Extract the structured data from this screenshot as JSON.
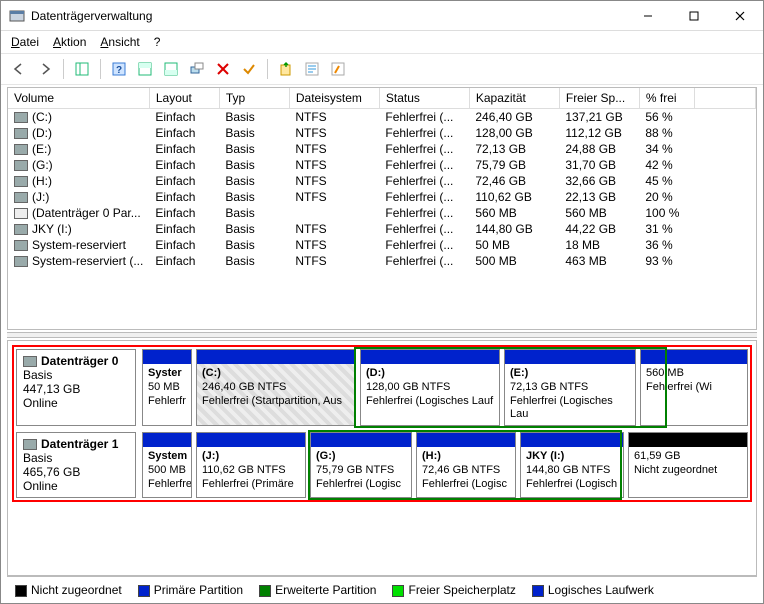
{
  "window": {
    "title": "Datenträgerverwaltung"
  },
  "menu": {
    "file": "Datei",
    "action": "Aktion",
    "view": "Ansicht",
    "help": "?"
  },
  "columns": {
    "c0": "Volume",
    "c1": "Layout",
    "c2": "Typ",
    "c3": "Dateisystem",
    "c4": "Status",
    "c5": "Kapazität",
    "c6": "Freier Sp...",
    "c7": "% frei"
  },
  "volumes": [
    {
      "name": "(C:)",
      "layout": "Einfach",
      "typ": "Basis",
      "fs": "NTFS",
      "status": "Fehlerfrei (...",
      "cap": "246,40 GB",
      "free": "137,21 GB",
      "pct": "56 %",
      "icon": "drv"
    },
    {
      "name": "(D:)",
      "layout": "Einfach",
      "typ": "Basis",
      "fs": "NTFS",
      "status": "Fehlerfrei (...",
      "cap": "128,00 GB",
      "free": "112,12 GB",
      "pct": "88 %",
      "icon": "drv"
    },
    {
      "name": "(E:)",
      "layout": "Einfach",
      "typ": "Basis",
      "fs": "NTFS",
      "status": "Fehlerfrei (...",
      "cap": "72,13 GB",
      "free": "24,88 GB",
      "pct": "34 %",
      "icon": "drv"
    },
    {
      "name": "(G:)",
      "layout": "Einfach",
      "typ": "Basis",
      "fs": "NTFS",
      "status": "Fehlerfrei (...",
      "cap": "75,79 GB",
      "free": "31,70 GB",
      "pct": "42 %",
      "icon": "drv"
    },
    {
      "name": "(H:)",
      "layout": "Einfach",
      "typ": "Basis",
      "fs": "NTFS",
      "status": "Fehlerfrei (...",
      "cap": "72,46 GB",
      "free": "32,66 GB",
      "pct": "45 %",
      "icon": "drv"
    },
    {
      "name": "(J:)",
      "layout": "Einfach",
      "typ": "Basis",
      "fs": "NTFS",
      "status": "Fehlerfrei (...",
      "cap": "110,62 GB",
      "free": "22,13 GB",
      "pct": "20 %",
      "icon": "drv"
    },
    {
      "name": "(Datenträger 0 Par...",
      "layout": "Einfach",
      "typ": "Basis",
      "fs": "",
      "status": "Fehlerfrei (...",
      "cap": "560 MB",
      "free": "560 MB",
      "pct": "100 %",
      "icon": "pack"
    },
    {
      "name": "JKY  (I:)",
      "layout": "Einfach",
      "typ": "Basis",
      "fs": "NTFS",
      "status": "Fehlerfrei (...",
      "cap": "144,80 GB",
      "free": "44,22 GB",
      "pct": "31 %",
      "icon": "drv"
    },
    {
      "name": "System-reserviert",
      "layout": "Einfach",
      "typ": "Basis",
      "fs": "NTFS",
      "status": "Fehlerfrei (...",
      "cap": "50 MB",
      "free": "18 MB",
      "pct": "36 %",
      "icon": "drv"
    },
    {
      "name": "System-reserviert (...",
      "layout": "Einfach",
      "typ": "Basis",
      "fs": "NTFS",
      "status": "Fehlerfrei (...",
      "cap": "500 MB",
      "free": "463 MB",
      "pct": "93 %",
      "icon": "drv"
    }
  ],
  "disk0": {
    "title": "Datenträger 0",
    "type": "Basis",
    "cap": "447,13 GB",
    "state": "Online",
    "p0": {
      "name": "Syster",
      "size": "50 MB",
      "stat": "Fehlerfr"
    },
    "p1": {
      "name": "(C:)",
      "size": "246,40 GB NTFS",
      "stat": "Fehlerfrei (Startpartition, Aus"
    },
    "p2": {
      "name": "(D:)",
      "size": "128,00 GB NTFS",
      "stat": "Fehlerfrei (Logisches Lauf"
    },
    "p3": {
      "name": "(E:)",
      "size": "72,13 GB NTFS",
      "stat": "Fehlerfrei (Logisches Lau"
    },
    "p4": {
      "name": "",
      "size": "560 MB",
      "stat": "Fehlerfrei (Wi"
    }
  },
  "disk1": {
    "title": "Datenträger 1",
    "type": "Basis",
    "cap": "465,76 GB",
    "state": "Online",
    "p0": {
      "name": "System",
      "size": "500 MB",
      "stat": "Fehlerfre"
    },
    "p1": {
      "name": "(J:)",
      "size": "110,62 GB NTFS",
      "stat": "Fehlerfrei (Primäre"
    },
    "p2": {
      "name": "(G:)",
      "size": "75,79 GB NTFS",
      "stat": "Fehlerfrei (Logisc"
    },
    "p3": {
      "name": "(H:)",
      "size": "72,46 GB NTFS",
      "stat": "Fehlerfrei (Logisc"
    },
    "p4": {
      "name": "JKY  (I:)",
      "size": "144,80 GB NTFS",
      "stat": "Fehlerfrei (Logisch"
    },
    "p5": {
      "name": "",
      "size": "61,59 GB",
      "stat": "Nicht zugeordnet"
    }
  },
  "legend": {
    "unalloc": "Nicht zugeordnet",
    "primary": "Primäre Partition",
    "ext": "Erweiterte Partition",
    "free": "Freier Speicherplatz",
    "logical": "Logisches Laufwerk"
  }
}
